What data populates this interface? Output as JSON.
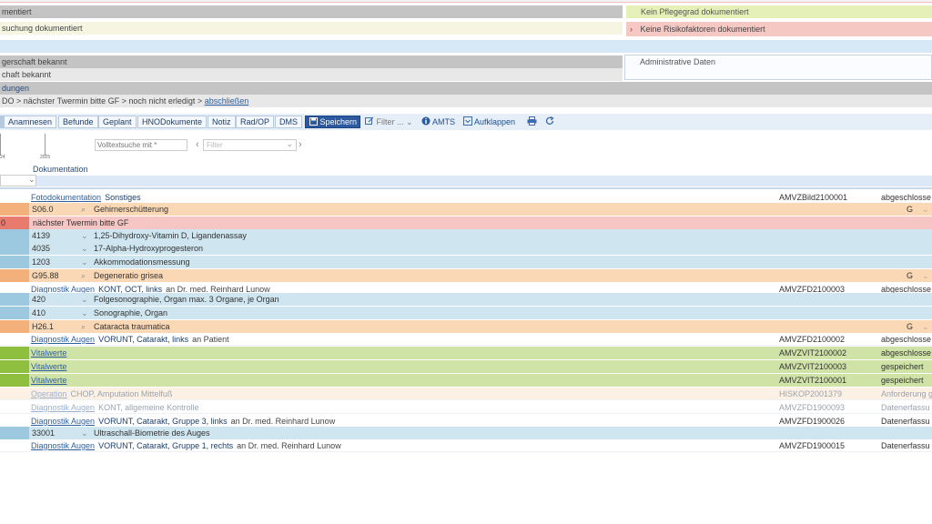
{
  "top_panels": {
    "left1": "mentiert",
    "left2": "suchung dokumentiert",
    "right1": "Kein Pflegegrad dokumentiert",
    "right2_arrow": "›",
    "right2": "Keine Risikofaktoren dokumentiert",
    "left3": "gerschaft bekannt",
    "left4": "chaft bekannt",
    "right3": "Administrative Daten",
    "left5": "dungen",
    "breadcrumb": "DO > nächster Twermin bitte GF > noch nicht erledigt >",
    "breadcrumb_link": "abschließen"
  },
  "toolbar": {
    "anamnesen": "Anamnesen",
    "befunde": "Befunde",
    "geplant": "Geplant",
    "hno": "HNODokumente",
    "notiz": "Notiz",
    "radop": "Rad/OP",
    "dms": "DMS",
    "speichern": "Speichern",
    "filter": "Filter ...",
    "amts": "AMTS",
    "aufklappen": "Aufklappen"
  },
  "filterbar": {
    "timeline_label1": "24",
    "timeline_label2": "2025",
    "fulltext_placeholder": "Volltextsuche mit *",
    "filter_placeholder": "Filter",
    "column_header": "Dokumentation",
    "col_chevron": "⌄"
  },
  "rows": [
    {
      "type": "doc",
      "link": "Fotodokumentation",
      "title": "Sonstiges",
      "suffix": "",
      "code": "AMVZBild2100001",
      "status": "abgeschlosse",
      "color": "#ffffff",
      "accent": "#ffffff"
    },
    {
      "type": "dx",
      "code_left": "S06.0",
      "text": "Gehirnerschütterung",
      "right": "G",
      "color": "#fbd8b5",
      "accent": "#f4b07a"
    },
    {
      "type": "note",
      "lead": "0",
      "text": "nächster Twermin bitte GF",
      "color": "#f5c6c3",
      "accent": "#e87a6e"
    },
    {
      "type": "svc",
      "code_left": "4139",
      "text": "1,25-Dihydroxy-Vitamin D, Ligandenassay",
      "color": "#cfe5ef",
      "accent": "#9cc9df"
    },
    {
      "type": "svc",
      "code_left": "4035",
      "text": "17-Alpha-Hydroxyprogesteron",
      "color": "#cfe5ef",
      "accent": "#9cc9df"
    },
    {
      "type": "svc",
      "code_left": "1203",
      "text": "Akkommodationsmessung",
      "color": "#cfe5ef",
      "accent": "#9cc9df"
    },
    {
      "type": "dx",
      "code_left": "G95.88",
      "text": "Degeneratio grisea",
      "right": "G",
      "color": "#fbd8b5",
      "accent": "#f4b07a"
    },
    {
      "type": "doc",
      "link": "Diagnostik Augen",
      "title": "KONT, OCT, links",
      "suffix": "an Dr. med. Reinhard Lunow",
      "code": "AMVZFD2100003",
      "status": "abgeschlosse",
      "color": "#ffffff",
      "accent": "#ffffff"
    },
    {
      "type": "svc",
      "code_left": "420",
      "text": "Folgesonographie, Organ max. 3 Organe, je Organ",
      "color": "#cfe5ef",
      "accent": "#9cc9df"
    },
    {
      "type": "svc",
      "code_left": "410",
      "text": "Sonographie, Organ",
      "color": "#cfe5ef",
      "accent": "#9cc9df"
    },
    {
      "type": "dx",
      "code_left": "H26.1",
      "text": "Cataracta traumatica",
      "right": "G",
      "color": "#fbd8b5",
      "accent": "#f4b07a"
    },
    {
      "type": "doc",
      "link": "Diagnostik Augen",
      "title": "VORUNT, Catarakt, links",
      "suffix": "an Patient",
      "code": "AMVZFD2100002",
      "status": "abgeschlosse",
      "color": "#ffffff",
      "accent": "#ffffff"
    },
    {
      "type": "vital",
      "link": "Vitalwerte",
      "code": "AMVZVIT2100002",
      "status": "abgeschlosse",
      "color": "#cfe3a6",
      "accent": "#8fbf3f"
    },
    {
      "type": "vital",
      "link": "Vitalwerte",
      "code": "AMVZVIT2100003",
      "status": "gespeichert",
      "color": "#cfe3a6",
      "accent": "#8fbf3f"
    },
    {
      "type": "vital",
      "link": "Vitalwerte",
      "code": "AMVZVIT2100001",
      "status": "gespeichert",
      "color": "#cfe3a6",
      "accent": "#8fbf3f"
    },
    {
      "type": "faded",
      "link": "Operation",
      "title": "CHOP, Amputation Mittelfuß",
      "code": "HISKOP2001379",
      "status": "Anforderung g",
      "color": "#fdf1e6",
      "accent": "#fbe0c8"
    },
    {
      "type": "faded",
      "link": "Diagnostik Augen",
      "title": "KONT, allgemeine Kontrolle",
      "code": "AMVZFD1900093",
      "status": "Datenerfassu",
      "color": "#ffffff",
      "accent": "#ffffff"
    },
    {
      "type": "doc",
      "link": "Diagnostik Augen",
      "title": "VORUNT, Catarakt, Gruppe 3, links",
      "suffix": "an Dr. med. Reinhard Lunow",
      "code": "AMVZFD1900026",
      "status": "Datenerfassu",
      "color": "#ffffff",
      "accent": "#ffffff"
    },
    {
      "type": "svc",
      "code_left": "33001",
      "text": "Ultraschall-Biometrie des Auges",
      "color": "#cfe5ef",
      "accent": "#9cc9df"
    },
    {
      "type": "doc",
      "link": "Diagnostik Augen",
      "title": "VORUNT, Catarakt, Gruppe 1, rechts",
      "suffix": "an Dr. med. Reinhard Lunow",
      "code": "AMVZFD1900015",
      "status": "Datenerfassu",
      "color": "#ffffff",
      "accent": "#ffffff"
    }
  ]
}
